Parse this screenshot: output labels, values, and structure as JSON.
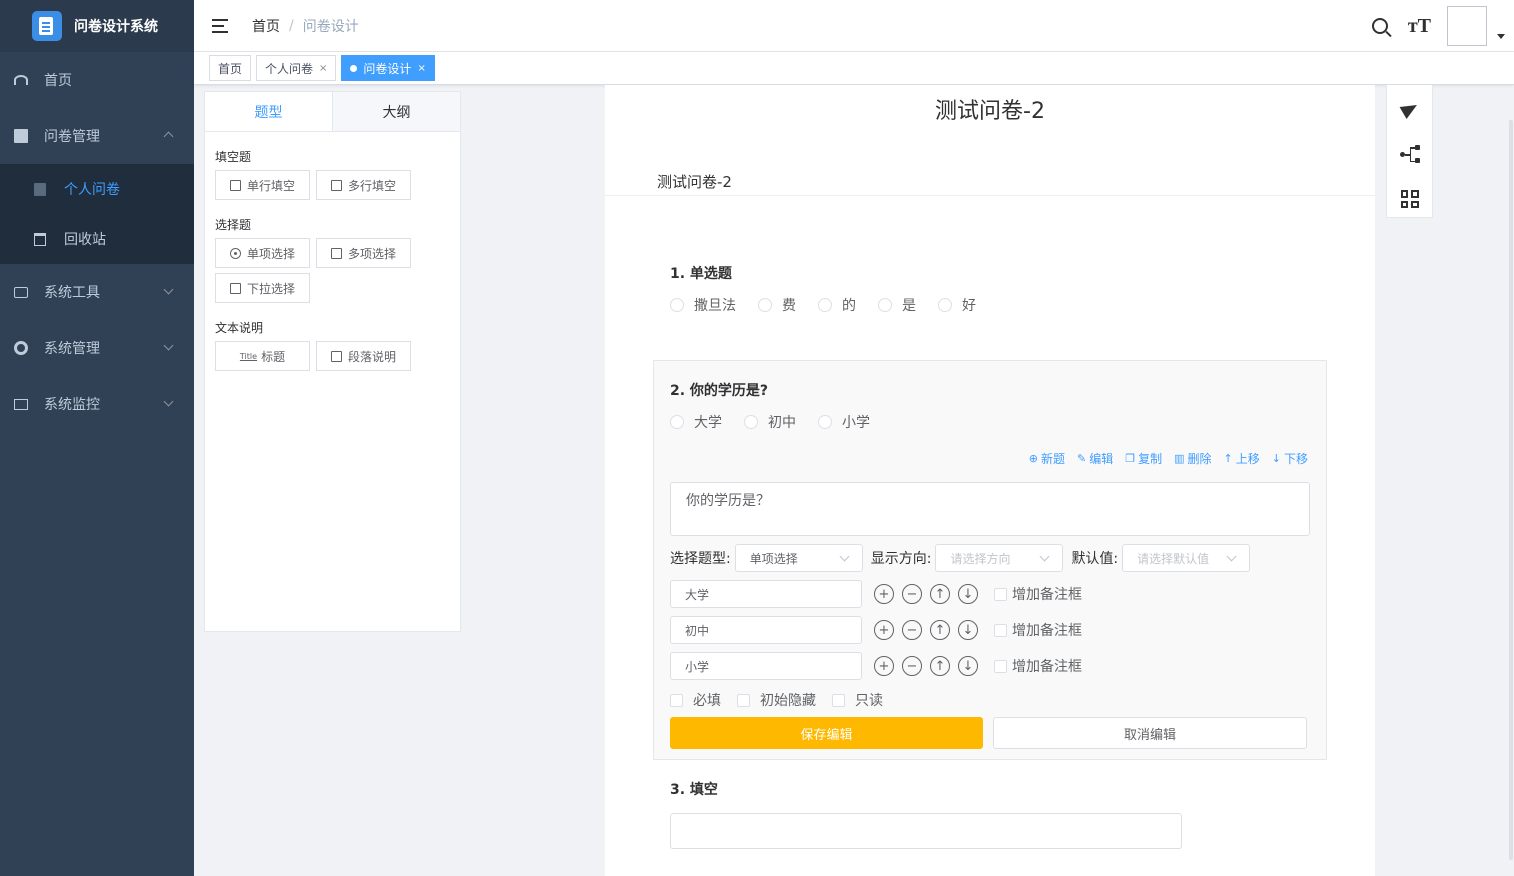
{
  "app": {
    "title": "问卷设计系统"
  },
  "sidebar": {
    "items": [
      {
        "label": "首页",
        "icon": "dashboard-icon"
      },
      {
        "label": "问卷管理",
        "icon": "document-icon",
        "expanded": true
      },
      {
        "label": "系统工具",
        "icon": "toolbox-icon"
      },
      {
        "label": "系统管理",
        "icon": "gear-icon"
      },
      {
        "label": "系统监控",
        "icon": "monitor-icon"
      }
    ],
    "subitems": [
      {
        "label": "个人问卷",
        "icon": "document-icon",
        "active": true
      },
      {
        "label": "回收站",
        "icon": "trash-icon"
      }
    ]
  },
  "header": {
    "breadcrumb": [
      "首页",
      "问卷设计"
    ]
  },
  "tags": [
    {
      "label": "首页"
    },
    {
      "label": "个人问卷",
      "close": "×"
    },
    {
      "label": "问卷设计",
      "close": "×",
      "active": true
    }
  ],
  "palette": {
    "tabs": [
      "题型",
      "大纲"
    ],
    "groups": [
      {
        "title": "填空题",
        "buttons": [
          "单行填空",
          "多行填空"
        ]
      },
      {
        "title": "选择题",
        "buttons": [
          "单项选择",
          "多项选择",
          "下拉选择"
        ]
      },
      {
        "title": "文本说明",
        "buttons": [
          "标题",
          "段落说明"
        ],
        "title_icon_text": "Title"
      }
    ]
  },
  "survey": {
    "title": "测试问卷-2",
    "description": "测试问卷-2",
    "q1": {
      "title": "1. 单选题",
      "options": [
        "撒旦法",
        "费",
        "的",
        "是",
        "好"
      ]
    },
    "q2": {
      "title": "2. 你的学历是?",
      "options": [
        "大学",
        "初中",
        "小学"
      ],
      "actions": [
        "新题",
        "编辑",
        "复制",
        "删除",
        "上移",
        "下移"
      ],
      "text": "你的学历是？",
      "type_label": "选择题型:",
      "type_value": "单项选择",
      "direction_label": "显示方向:",
      "direction_placeholder": "请选择方向",
      "default_label": "默认值:",
      "default_placeholder": "请选择默认值",
      "remark_label": "增加备注框",
      "flags": [
        "必填",
        "初始隐藏",
        "只读"
      ],
      "save": "保存编辑",
      "cancel": "取消编辑"
    },
    "q3": {
      "title": "3. 填空"
    }
  },
  "colors": {
    "sidebar": "#304156",
    "accent": "#409eff",
    "save": "#ffb800"
  }
}
